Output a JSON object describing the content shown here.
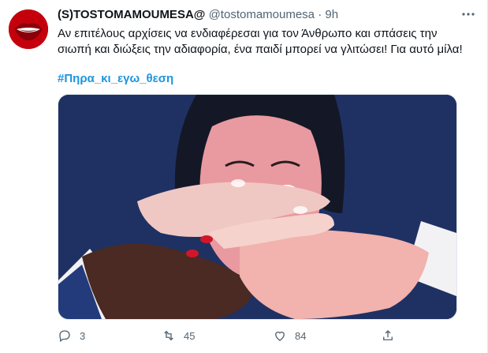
{
  "tweet": {
    "display_name": "(S)TOSTOMAMOUMESA@",
    "handle": "@tostomamoumesa",
    "separator": "·",
    "time": "9h",
    "text": "Αν επιτέλους αρχίσεις να ενδιαφέρεσαι για τον Άνθρωπο και σπάσεις την σιωπή και διώξεις την αδιαφορία, ένα παιδί μπορεί να γλιτώσει! Για αυτό μίλα!",
    "hashtag": "#Πηρα_κι_εγω_θεση",
    "replies": "3",
    "retweets": "45",
    "likes": "84"
  },
  "icons": {
    "avatar": "red-lips-avatar",
    "more": "more-dots-icon",
    "reply": "reply-icon",
    "retweet": "retweet-icon",
    "like": "heart-icon",
    "share": "share-icon"
  },
  "colors": {
    "hashtag": "#1b95e0",
    "muted": "#536471",
    "avatar_bg": "#b3000b",
    "media_bg": "#1c2d5e"
  }
}
